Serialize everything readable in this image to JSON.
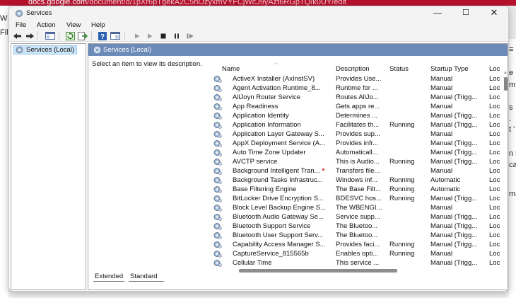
{
  "background": {
    "url_prefix": "docs.google.com",
    "url_rest": "/document/d/1pXr6pTgekA2C5nOzyxmVYFCjWcJ9yAzt6RGpTQ/k0UY/edit",
    "left_fragments": [
      "W",
      "Fil"
    ],
    "right_fragments": [
      "≡",
      "e",
      "m",
      "s",
      ".",
      "t '",
      "n i",
      "ca",
      "ma"
    ]
  },
  "window": {
    "title": "Services",
    "controls": {
      "minimize": "—",
      "maximize": "☐",
      "close": "✕"
    }
  },
  "menu": [
    "File",
    "Action",
    "View",
    "Help"
  ],
  "tree": {
    "root_label": "Services (Local)"
  },
  "pane": {
    "header": "Services (Local)",
    "description_hint": "Select an item to view its description."
  },
  "columns": [
    "Name",
    "Description",
    "Status",
    "Startup Type",
    "Loc"
  ],
  "services": [
    {
      "name": "ActiveX Installer (AxInstSV)",
      "desc": "Provides Use...",
      "status": "",
      "startup": "Manual",
      "log": "Loc"
    },
    {
      "name": "Agent Activation Runtime_8...",
      "desc": "Runtime for ...",
      "status": "",
      "startup": "Manual",
      "log": "Loc"
    },
    {
      "name": "AllJoyn Router Service",
      "desc": "Routes AllJo...",
      "status": "",
      "startup": "Manual (Trigg...",
      "log": "Loc"
    },
    {
      "name": "App Readiness",
      "desc": "Gets apps re...",
      "status": "",
      "startup": "Manual",
      "log": "Loc"
    },
    {
      "name": "Application Identity",
      "desc": "Determines ...",
      "status": "",
      "startup": "Manual (Trigg...",
      "log": "Loc"
    },
    {
      "name": "Application Information",
      "desc": "Facilitates th...",
      "status": "Running",
      "startup": "Manual (Trigg...",
      "log": "Loc"
    },
    {
      "name": "Application Layer Gateway S...",
      "desc": "Provides sup...",
      "status": "",
      "startup": "Manual",
      "log": "Loc"
    },
    {
      "name": "AppX Deployment Service (A...",
      "desc": "Provides infr...",
      "status": "",
      "startup": "Manual (Trigg...",
      "log": "Loc"
    },
    {
      "name": "Auto Time Zone Updater",
      "desc": "Automaticall...",
      "status": "",
      "startup": "Manual (Trigg...",
      "log": "Loc"
    },
    {
      "name": "AVCTP service",
      "desc": "This is Audio...",
      "status": "Running",
      "startup": "Manual (Trigg...",
      "log": "Loc"
    },
    {
      "name": "Background Intelligent Tran...",
      "desc": "Transfers file...",
      "status": "",
      "startup": "Manual",
      "log": "Loc"
    },
    {
      "name": "Background Tasks Infrastruc...",
      "desc": "Windows inf...",
      "status": "Running",
      "startup": "Automatic",
      "log": "Loc"
    },
    {
      "name": "Base Filtering Engine",
      "desc": "The Base Filt...",
      "status": "Running",
      "startup": "Automatic",
      "log": "Loc"
    },
    {
      "name": "BitLocker Drive Encryption S...",
      "desc": "BDESVC hos...",
      "status": "Running",
      "startup": "Manual (Trigg...",
      "log": "Loc"
    },
    {
      "name": "Block Level Backup Engine S...",
      "desc": "The WBENGI...",
      "status": "",
      "startup": "Manual",
      "log": "Loc"
    },
    {
      "name": "Bluetooth Audio Gateway Se...",
      "desc": "Service supp...",
      "status": "",
      "startup": "Manual (Trigg...",
      "log": "Loc"
    },
    {
      "name": "Bluetooth Support Service",
      "desc": "The Bluetoo...",
      "status": "",
      "startup": "Manual (Trigg...",
      "log": "Loc"
    },
    {
      "name": "Bluetooth User Support Serv...",
      "desc": "The Bluetoo...",
      "status": "",
      "startup": "Manual (Trigg...",
      "log": "Loc"
    },
    {
      "name": "Capability Access Manager S...",
      "desc": "Provides faci...",
      "status": "Running",
      "startup": "Manual (Trigg...",
      "log": "Loc"
    },
    {
      "name": "CaptureService_815565b",
      "desc": "Enables opti...",
      "status": "Running",
      "startup": "Manual",
      "log": "Loc"
    },
    {
      "name": "Cellular Time",
      "desc": "This service ...",
      "status": "",
      "startup": "Manual (Trigg...",
      "log": "Loc"
    }
  ],
  "tabs": [
    "Extended",
    "Standard"
  ],
  "colors": {
    "pane_header_bg": "#6d8bb8",
    "tree_selected_bg": "#cce4f7",
    "browser_bar": "#b4112d"
  }
}
